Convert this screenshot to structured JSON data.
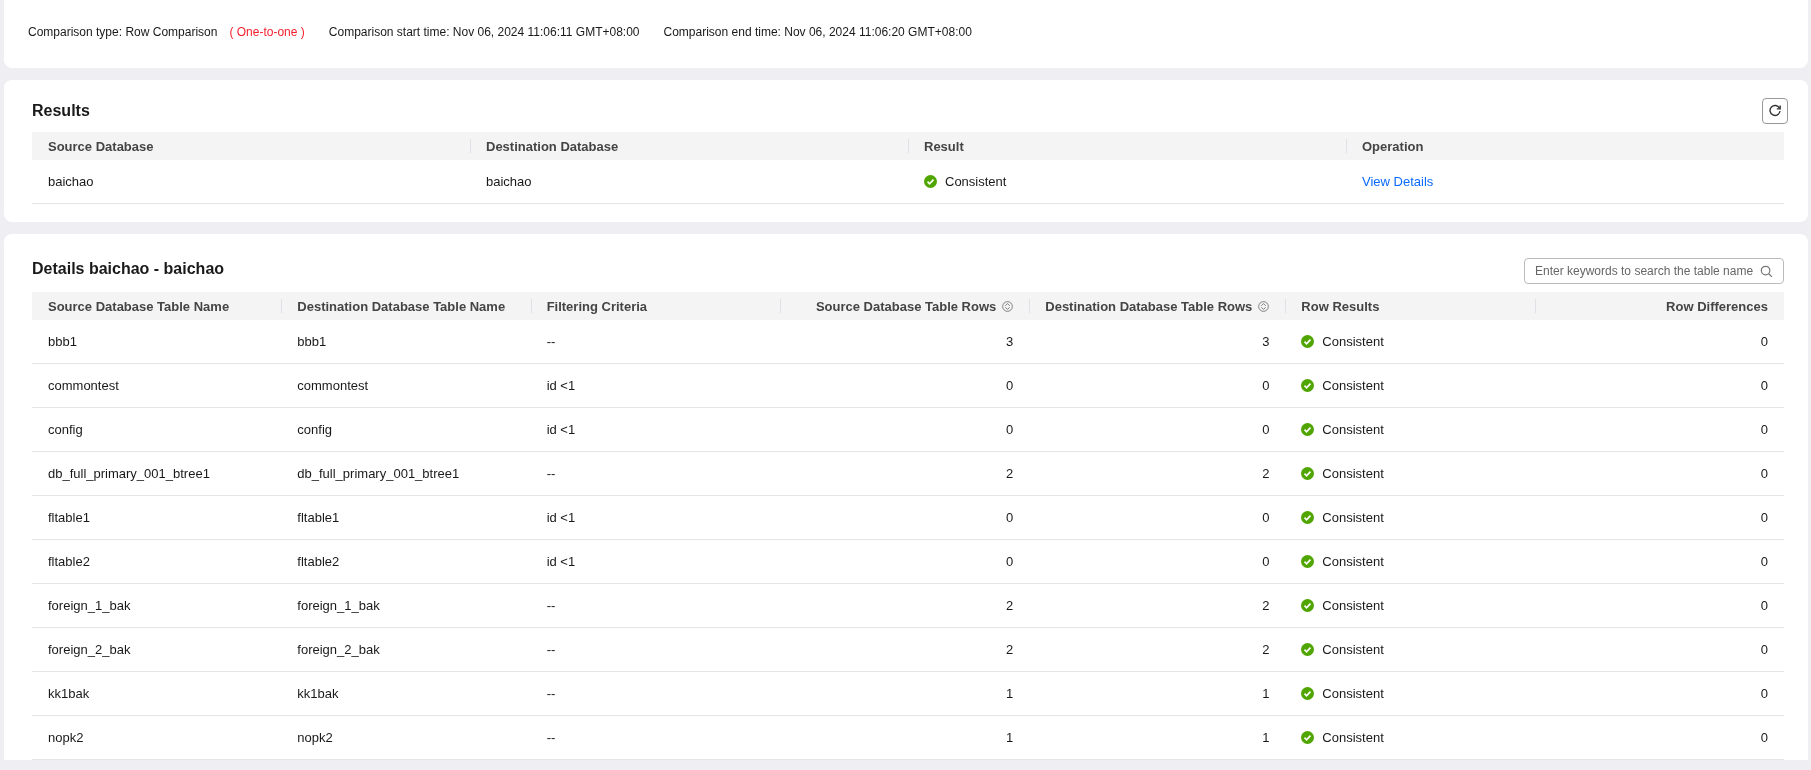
{
  "summary": {
    "type_label": "Comparison type: Row Comparison",
    "type_mode": "( One-to-one )",
    "start_time": "Comparison start time: Nov 06, 2024 11:06:11 GMT+08:00",
    "end_time": "Comparison end time: Nov 06, 2024 11:06:20 GMT+08:00"
  },
  "results": {
    "title": "Results",
    "columns": [
      "Source Database",
      "Destination Database",
      "Result",
      "Operation"
    ],
    "rows": [
      {
        "source": "baichao",
        "destination": "baichao",
        "result": {
          "text": "Consistent",
          "consistent": true
        },
        "operation": "View Details"
      }
    ]
  },
  "details": {
    "title": "Details baichao - baichao",
    "search": {
      "placeholder": "Enter keywords to search the table name"
    },
    "columns": [
      {
        "label": "Source Database Table Name",
        "sortable": false
      },
      {
        "label": "Destination Database Table Name",
        "sortable": false
      },
      {
        "label": "Filtering Criteria",
        "sortable": false
      },
      {
        "label": "Source Database Table Rows",
        "sortable": true
      },
      {
        "label": "Destination Database Table Rows",
        "sortable": true
      },
      {
        "label": "Row Results",
        "sortable": false
      },
      {
        "label": "Row Differences",
        "sortable": false
      }
    ],
    "rows": [
      {
        "source": "bbb1",
        "destination": "bbb1",
        "filter": "--",
        "source_rows": "3",
        "destination_rows": "3",
        "result": {
          "text": "Consistent",
          "consistent": true
        },
        "differences": "0"
      },
      {
        "source": "commontest",
        "destination": "commontest",
        "filter": "id <1",
        "source_rows": "0",
        "destination_rows": "0",
        "result": {
          "text": "Consistent",
          "consistent": true
        },
        "differences": "0"
      },
      {
        "source": "config",
        "destination": "config",
        "filter": "id <1",
        "source_rows": "0",
        "destination_rows": "0",
        "result": {
          "text": "Consistent",
          "consistent": true
        },
        "differences": "0"
      },
      {
        "source": "db_full_primary_001_btree1",
        "destination": "db_full_primary_001_btree1",
        "filter": "--",
        "source_rows": "2",
        "destination_rows": "2",
        "result": {
          "text": "Consistent",
          "consistent": true
        },
        "differences": "0"
      },
      {
        "source": "fltable1",
        "destination": "fltable1",
        "filter": "id <1",
        "source_rows": "0",
        "destination_rows": "0",
        "result": {
          "text": "Consistent",
          "consistent": true
        },
        "differences": "0"
      },
      {
        "source": "fltable2",
        "destination": "fltable2",
        "filter": "id <1",
        "source_rows": "0",
        "destination_rows": "0",
        "result": {
          "text": "Consistent",
          "consistent": true
        },
        "differences": "0"
      },
      {
        "source": "foreign_1_bak",
        "destination": "foreign_1_bak",
        "filter": "--",
        "source_rows": "2",
        "destination_rows": "2",
        "result": {
          "text": "Consistent",
          "consistent": true
        },
        "differences": "0"
      },
      {
        "source": "foreign_2_bak",
        "destination": "foreign_2_bak",
        "filter": "--",
        "source_rows": "2",
        "destination_rows": "2",
        "result": {
          "text": "Consistent",
          "consistent": true
        },
        "differences": "0"
      },
      {
        "source": "kk1bak",
        "destination": "kk1bak",
        "filter": "--",
        "source_rows": "1",
        "destination_rows": "1",
        "result": {
          "text": "Consistent",
          "consistent": true
        },
        "differences": "0"
      },
      {
        "source": "nopk2",
        "destination": "nopk2",
        "filter": "--",
        "source_rows": "1",
        "destination_rows": "1",
        "result": {
          "text": "Consistent",
          "consistent": true
        },
        "differences": "0"
      }
    ]
  }
}
